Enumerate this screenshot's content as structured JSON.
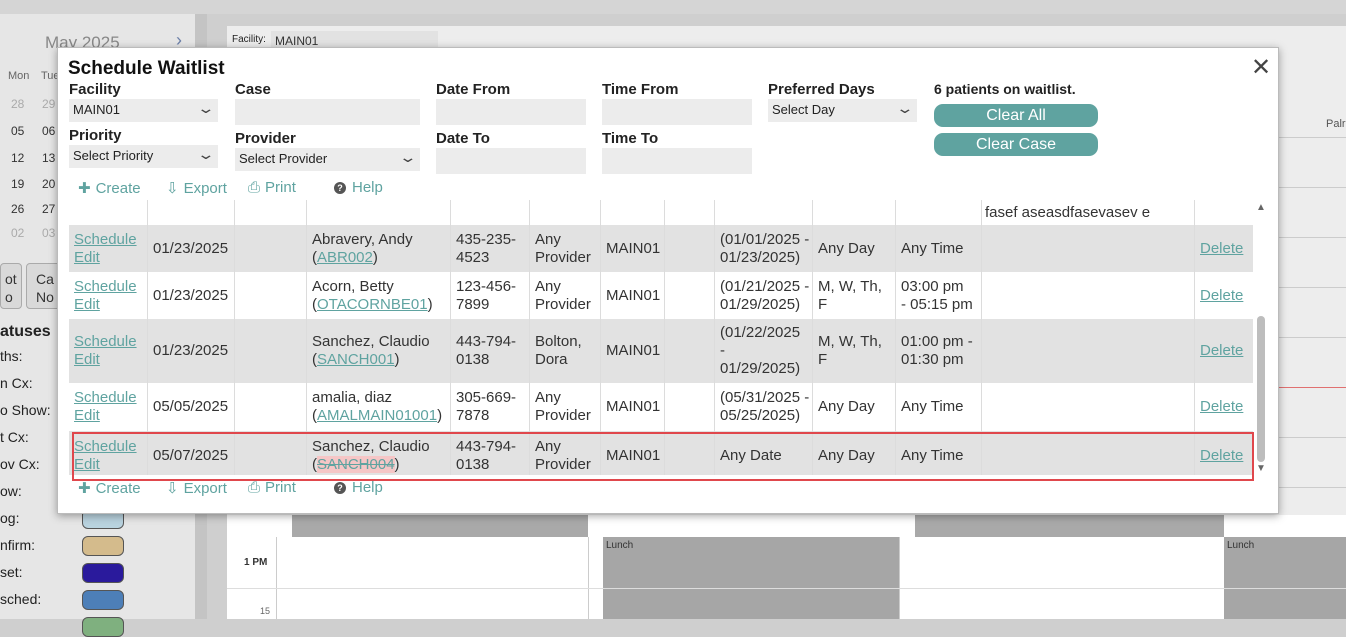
{
  "background": {
    "calendar": {
      "month_label": "May 2025",
      "next_icon": "chevron-right-icon",
      "days_of_week": [
        "Mon",
        "Tue"
      ],
      "weeks": [
        [
          "28",
          "29"
        ],
        [
          "05",
          "06"
        ],
        [
          "12",
          "13"
        ],
        [
          "19",
          "20"
        ],
        [
          "26",
          "27"
        ],
        [
          "02",
          "03"
        ]
      ]
    },
    "side_buttons": [
      {
        "line1": "ot",
        "line2": "o"
      },
      {
        "line1": "Ca",
        "line2": "No"
      }
    ],
    "statuses_title": "atuses",
    "statuses": [
      {
        "label": "ths:",
        "color": ""
      },
      {
        "label": "n Cx:",
        "color": ""
      },
      {
        "label": "o Show:",
        "color": ""
      },
      {
        "label": "t Cx:",
        "color": ""
      },
      {
        "label": "ov Cx:",
        "color": ""
      },
      {
        "label": "ow:",
        "color": ""
      },
      {
        "label": "og:",
        "color": "#b9d3df"
      },
      {
        "label": "nfirm:",
        "color": "#d4bb8c"
      },
      {
        "label": "set:",
        "color": "#2a1a9c"
      },
      {
        "label": "sched:",
        "color": "#4d7fb8"
      },
      {
        "label": "",
        "color": "#7fb07f"
      }
    ],
    "facility_label": "Facility:",
    "facility_value": "MAIN01",
    "time_1pm": "1 PM",
    "time_15": "15",
    "lunch_label": "Lunch",
    "palm_label": "Palr"
  },
  "modal": {
    "title": "Schedule Waitlist",
    "close_icon": "close-icon",
    "filters": {
      "facility": {
        "label": "Facility",
        "value": "MAIN01"
      },
      "priority": {
        "label": "Priority",
        "value": "Select Priority"
      },
      "case": {
        "label": "Case",
        "value": ""
      },
      "provider": {
        "label": "Provider",
        "value": "Select Provider"
      },
      "date_from": {
        "label": "Date From",
        "value": ""
      },
      "date_to": {
        "label": "Date To",
        "value": ""
      },
      "time_from": {
        "label": "Time From",
        "value": ""
      },
      "time_to": {
        "label": "Time To",
        "value": ""
      },
      "preferred_days": {
        "label": "Preferred Days",
        "value": "Select Day"
      }
    },
    "waitlist_count": "6 patients on waitlist.",
    "clear_all_label": "Clear All",
    "clear_case_label": "Clear Case",
    "toolbar": {
      "create": "Create",
      "export": "Export",
      "print": "Print",
      "help": "Help"
    },
    "partial_row_note": "fasef aseasdfasevasev e",
    "rows": [
      {
        "schedule": "Schedule",
        "edit": "Edit",
        "date": "01/23/2025",
        "name": "Abravery, Andy",
        "account": "ABR002",
        "account_status": "normal",
        "phone": [
          "435-235-",
          "4523"
        ],
        "provider": [
          "Any",
          "Provider"
        ],
        "facility": "MAIN01",
        "date_range": [
          "(01/01/2025 -",
          "01/23/2025)"
        ],
        "days": [
          "Any Day"
        ],
        "time": [
          "Any Time"
        ],
        "note": "",
        "delete": "Delete"
      },
      {
        "schedule": "Schedule",
        "edit": "Edit",
        "date": "01/23/2025",
        "name": "Acorn, Betty",
        "account": "OTACORNBE01",
        "account_status": "normal",
        "phone": [
          "123-456-",
          "7899"
        ],
        "provider": [
          "Any",
          "Provider"
        ],
        "facility": "MAIN01",
        "date_range": [
          "(01/21/2025 -",
          "01/29/2025)"
        ],
        "days": [
          "M, W, Th,",
          "F"
        ],
        "time": [
          "03:00 pm",
          "- 05:15 pm"
        ],
        "note": "",
        "delete": "Delete"
      },
      {
        "schedule": "Schedule",
        "edit": "Edit",
        "date": "01/23/2025",
        "name": "Sanchez, Claudio",
        "account": "SANCH001",
        "account_status": "normal",
        "phone": [
          "443-794-",
          "0138"
        ],
        "provider": [
          "Bolton,",
          "Dora"
        ],
        "facility": "MAIN01",
        "date_range": [
          "(01/22/2025",
          "-",
          "01/29/2025)"
        ],
        "days": [
          "M, W, Th,",
          "F"
        ],
        "time": [
          "01:00 pm -",
          "01:30 pm"
        ],
        "note": "",
        "delete": "Delete"
      },
      {
        "schedule": "Schedule",
        "edit": "Edit",
        "date": "05/05/2025",
        "name": "amalia, diaz",
        "account": "AMALMAIN01001",
        "account_status": "normal",
        "phone": [
          "305-669-",
          "7878"
        ],
        "provider": [
          "Any",
          "Provider"
        ],
        "facility": "MAIN01",
        "date_range": [
          "(05/31/2025 -",
          "05/25/2025)"
        ],
        "days": [
          "Any Day"
        ],
        "time": [
          "Any Time"
        ],
        "note": "",
        "delete": "Delete"
      },
      {
        "schedule": "Schedule",
        "edit": "Edit",
        "date": "05/07/2025",
        "name": "Sanchez, Claudio",
        "account": "SANCH004",
        "account_status": "struck",
        "phone": [
          "443-794-",
          "0138"
        ],
        "provider": [
          "Any",
          "Provider"
        ],
        "facility": "MAIN01",
        "date_range": [
          "Any Date"
        ],
        "days": [
          "Any Day"
        ],
        "time": [
          "Any Time"
        ],
        "note": "",
        "delete": "Delete"
      }
    ]
  },
  "colors": {
    "accent_teal": "#5fa3a0",
    "highlight_red": "#e0474c",
    "row_shade": "#e2e2e2"
  }
}
